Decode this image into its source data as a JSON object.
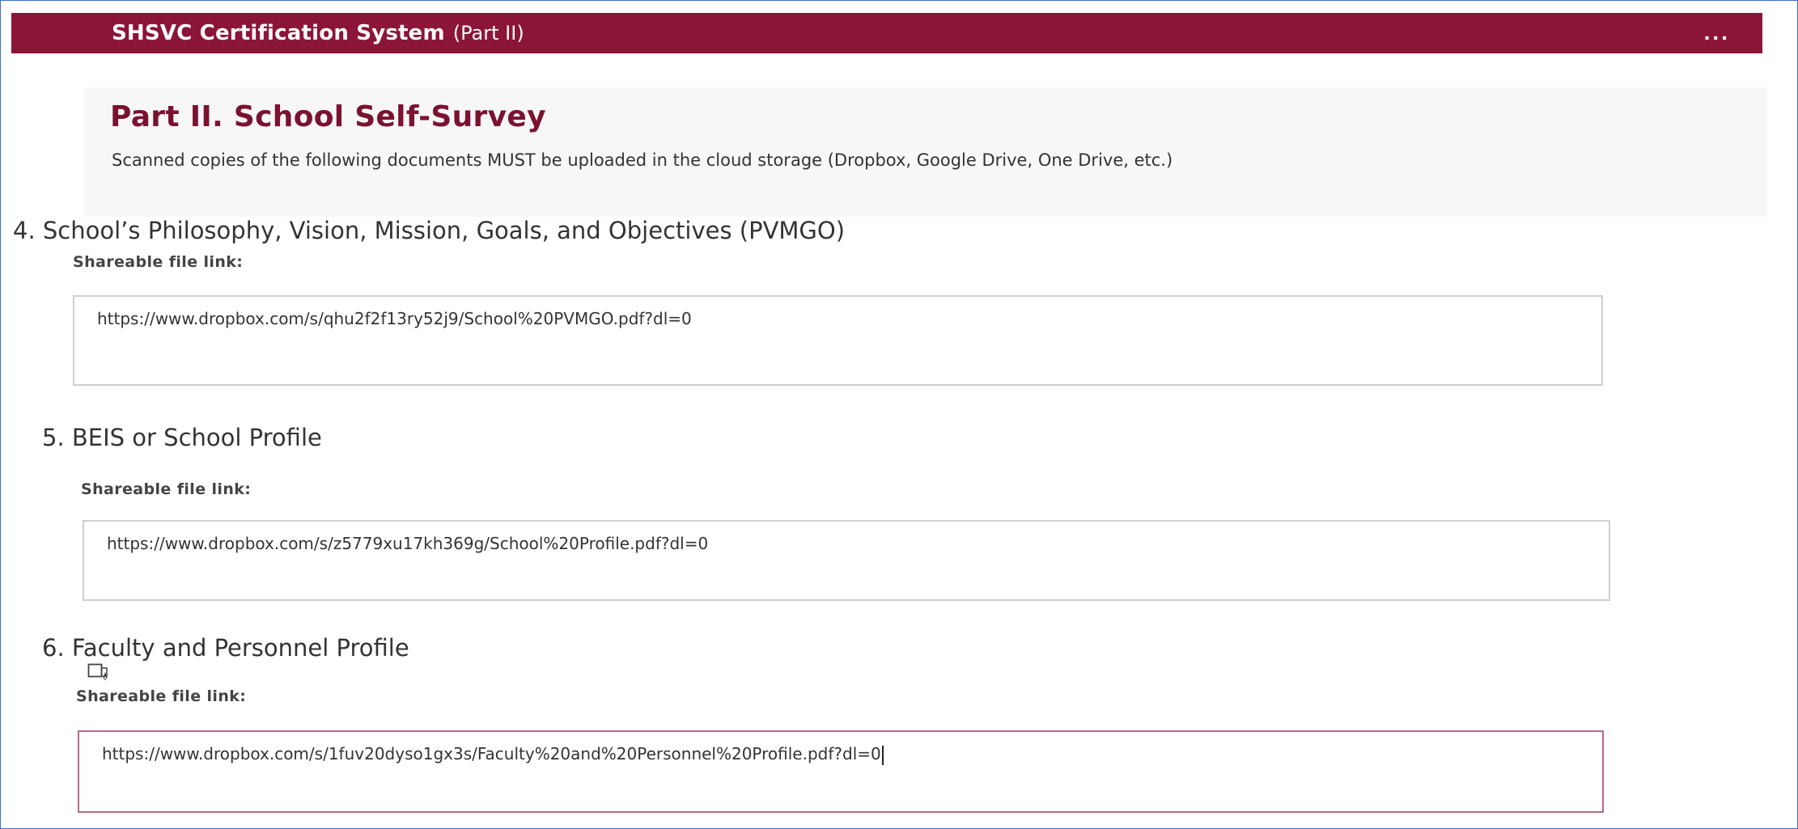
{
  "window": {
    "title": "SHSVC Certification System",
    "subtitle": "(Part II)",
    "more_label": "..."
  },
  "section": {
    "title": "Part II. School Self-Survey",
    "description": "Scanned copies of the following documents MUST be uploaded in the cloud storage (Dropbox, Google Drive, One Drive, etc.)"
  },
  "questions": [
    {
      "number": "4.",
      "title": "School’s Philosophy, Vision, Mission, Goals, and Objectives (PVMGO)",
      "field_label": "Shareable file link:",
      "value": "https://www.dropbox.com/s/qhu2f2f13ry52j9/School%20PVMGO.pdf?dl=0"
    },
    {
      "number": "5.",
      "title": "BEIS or School Profile",
      "field_label": "Shareable file link:",
      "value": "https://www.dropbox.com/s/z5779xu17kh369g/School%20Profile.pdf?dl=0"
    },
    {
      "number": "6.",
      "title": "Faculty and Personnel Profile",
      "field_label": "Shareable file link:",
      "value": "https://www.dropbox.com/s/1fuv20dyso1gx3s/Faculty%20and%20Personnel%20Profile.pdf?dl=0",
      "icon": "immersive-reader-icon"
    }
  ],
  "colors": {
    "titlebar": "#8b1538",
    "heading": "#7a1230",
    "active_border": "#b96a85",
    "frame_border": "#3a6fc9"
  }
}
